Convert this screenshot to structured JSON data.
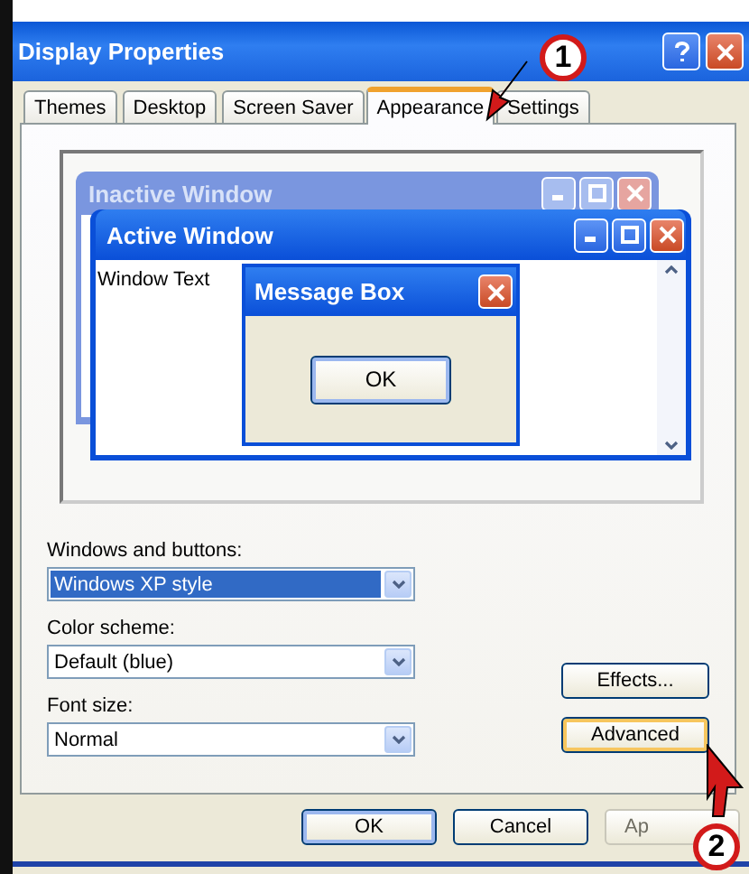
{
  "window": {
    "title": "Display Properties"
  },
  "tabs": [
    {
      "label": "Themes",
      "selected": false
    },
    {
      "label": "Desktop",
      "selected": false
    },
    {
      "label": "Screen Saver",
      "selected": false
    },
    {
      "label": "Appearance",
      "selected": true
    },
    {
      "label": "Settings",
      "selected": false
    }
  ],
  "preview": {
    "inactive_title": "Inactive Window",
    "active_title": "Active Window",
    "window_text": "Window Text",
    "message_title": "Message Box",
    "message_button": "OK"
  },
  "fields": [
    {
      "label": "Windows and buttons:",
      "value": "Windows XP style",
      "highlighted": true
    },
    {
      "label": "Color scheme:",
      "value": "Default (blue)",
      "highlighted": false
    },
    {
      "label": "Font size:",
      "value": "Normal",
      "highlighted": false
    }
  ],
  "side_buttons": [
    {
      "label": "Effects...",
      "focused": false
    },
    {
      "label": "Advanced",
      "focused": true
    }
  ],
  "footer_buttons": [
    {
      "label": "OK",
      "disabled": false,
      "default": true
    },
    {
      "label": "Cancel",
      "disabled": false,
      "default": false
    },
    {
      "label": "Ap",
      "disabled": true,
      "default": false
    }
  ],
  "annotations": [
    {
      "label": "1"
    },
    {
      "label": "2"
    }
  ]
}
